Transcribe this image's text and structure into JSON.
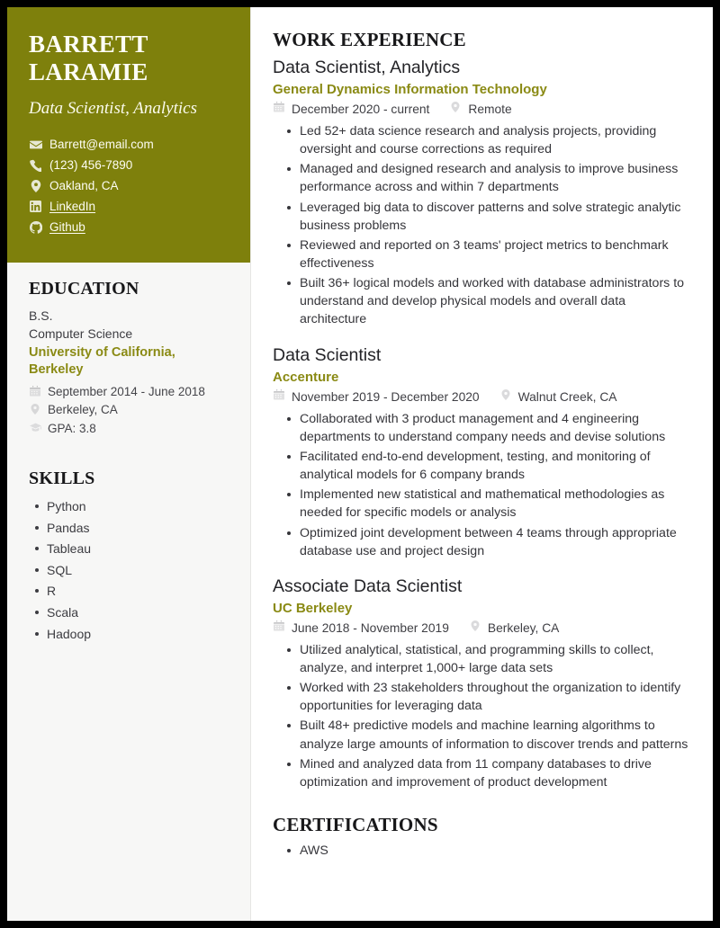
{
  "colors": {
    "header_bg": "#7e800c",
    "accent": "#8a8a14",
    "sidebar_bg": "#f7f7f6",
    "page_bg": "#ffffff",
    "border": "#000000",
    "text": "#35353a"
  },
  "sidebar": {
    "name": "BARRETT LARAMIE",
    "name_line1": "BARRETT",
    "name_line2": "LARAMIE",
    "headline": "Data Scientist, Analytics",
    "contact": [
      {
        "icon": "envelope-icon",
        "label": "Barrett@email.com",
        "link": false
      },
      {
        "icon": "phone-icon",
        "label": "(123) 456-7890",
        "link": false
      },
      {
        "icon": "location-pin-icon",
        "label": "Oakland, CA",
        "link": false
      },
      {
        "icon": "linkedin-icon",
        "label": "LinkedIn",
        "link": true
      },
      {
        "icon": "github-icon",
        "label": "Github",
        "link": true
      }
    ],
    "education": {
      "title": "EDUCATION",
      "degree": "B.S.",
      "field": "Computer Science",
      "school": "University of California, Berkeley",
      "dates": "September 2014 - June 2018",
      "location": "Berkeley, CA",
      "gpa": "GPA: 3.8"
    },
    "skills": {
      "title": "SKILLS",
      "items": [
        "Python",
        "Pandas",
        "Tableau",
        "SQL",
        "R",
        "Scala",
        "Hadoop"
      ]
    }
  },
  "main": {
    "work": {
      "title": "WORK EXPERIENCE",
      "jobs": [
        {
          "title": "Data Scientist, Analytics",
          "company": "General Dynamics Information Technology",
          "dates": "December 2020 - current",
          "location": "Remote",
          "bullets": [
            "Led 52+ data science research and analysis projects, providing oversight and course corrections as required",
            "Managed and designed research and analysis to improve business performance across and within 7 departments",
            "Leveraged big data to discover patterns and solve strategic analytic business problems",
            "Reviewed and reported on 3 teams' project metrics to benchmark effectiveness",
            "Built 36+ logical models and worked with database administrators to understand and develop physical models and overall data architecture"
          ]
        },
        {
          "title": "Data Scientist",
          "company": "Accenture",
          "dates": "November 2019 - December 2020",
          "location": "Walnut Creek, CA",
          "bullets": [
            "Collaborated with 3 product management and 4 engineering departments to understand company needs and devise solutions",
            "Facilitated end-to-end development, testing, and monitoring of analytical models for 6 company brands",
            "Implemented new statistical and mathematical methodologies as needed for specific models or analysis",
            "Optimized joint development between 4 teams through appropriate database use and project design"
          ]
        },
        {
          "title": "Associate Data Scientist",
          "company": "UC Berkeley",
          "dates": "June 2018 - November 2019",
          "location": "Berkeley, CA",
          "bullets": [
            "Utilized analytical, statistical, and programming skills to collect, analyze, and interpret 1,000+ large data sets",
            "Worked with 23 stakeholders throughout the organization to identify opportunities for leveraging data",
            "Built 48+ predictive models and machine learning algorithms to analyze large amounts of information to discover trends and patterns",
            "Mined and analyzed data from 11 company databases to drive optimization and improvement of product development"
          ]
        }
      ]
    },
    "certifications": {
      "title": "CERTIFICATIONS",
      "items": [
        "AWS"
      ]
    }
  }
}
